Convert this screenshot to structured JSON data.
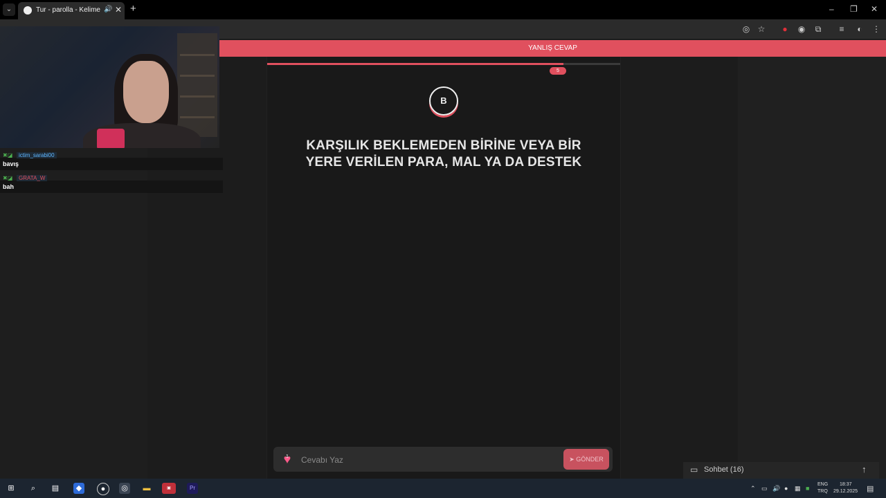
{
  "browser": {
    "tab_title": "Tur - parolla - Kelime oyunu",
    "audio_icon": "speaker-icon",
    "close_icon": "close-icon",
    "new_tab": "+",
    "win_min": "–",
    "win_max": "❐",
    "win_close": "✕"
  },
  "banner": {
    "text": "YANLIŞ CEVAP"
  },
  "game": {
    "progress": 0.84,
    "score_badge": "5",
    "letter": "B",
    "clue": "KARŞILIK BEKLEMEDEN BİRİNE VEYA BİR YERE VERİLEN PARA, MAL YA DA DESTEK",
    "lives": "1",
    "answer_placeholder": "Cevabı Yaz",
    "send_label": "GÖNDER"
  },
  "chat_toggle": {
    "label": "Sohbet (16)"
  },
  "stream_chat": [
    {
      "user": "ictim_sarabi00",
      "user_color": "#5fb7ff",
      "message": "bavış"
    },
    {
      "user": "GRATA_W",
      "user_color": "#e0505e",
      "message": "bah"
    }
  ],
  "taskbar": {
    "lang_top": "ENG",
    "lang_bottom": "TRQ",
    "time": "18:37",
    "date": "29.12.2025"
  },
  "colors": {
    "accent": "#e0505e",
    "bg": "#1a1a1a"
  }
}
